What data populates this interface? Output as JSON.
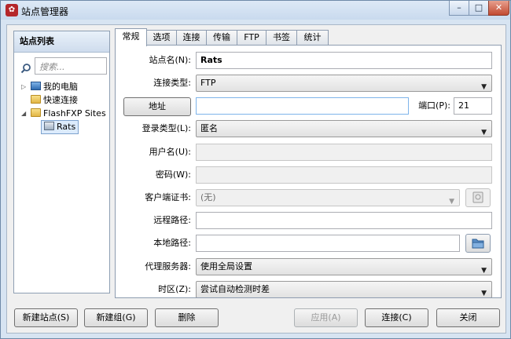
{
  "window": {
    "title": "站点管理器",
    "minimize": "–",
    "maximize": "□",
    "close": "✕"
  },
  "sidebar": {
    "header": "站点列表",
    "search_placeholder": "搜索...",
    "tree": [
      {
        "label": "我的电脑",
        "icon": "computer-icon"
      },
      {
        "label": "快速连接",
        "icon": "folder-icon"
      },
      {
        "label": "FlashFXP Sites",
        "icon": "folder-icon"
      },
      {
        "label": "Rats",
        "icon": "site-icon"
      }
    ]
  },
  "tabs": [
    "常规",
    "选项",
    "连接",
    "传输",
    "FTP",
    "书签",
    "统计"
  ],
  "form": {
    "site_name_label": "站点名(N):",
    "site_name_value": "Rats",
    "conn_type_label": "连接类型:",
    "conn_type_value": "FTP",
    "address_button": "地址",
    "address_value": "",
    "port_label": "端口(P):",
    "port_value": "21",
    "login_type_label": "登录类型(L):",
    "login_type_value": "匿名",
    "username_label": "用户名(U):",
    "password_label": "密码(W):",
    "client_cert_label": "客户端证书:",
    "client_cert_value": "(无)",
    "remote_path_label": "远程路径:",
    "local_path_label": "本地路径:",
    "proxy_label": "代理服务器:",
    "proxy_value": "使用全局设置",
    "timezone_label": "时区(Z):",
    "timezone_value": "尝试自动检测时差"
  },
  "footer": {
    "new_site": "新建站点(S)",
    "new_group": "新建组(G)",
    "delete": "删除",
    "apply": "应用(A)",
    "connect": "连接(C)",
    "close": "关闭"
  }
}
